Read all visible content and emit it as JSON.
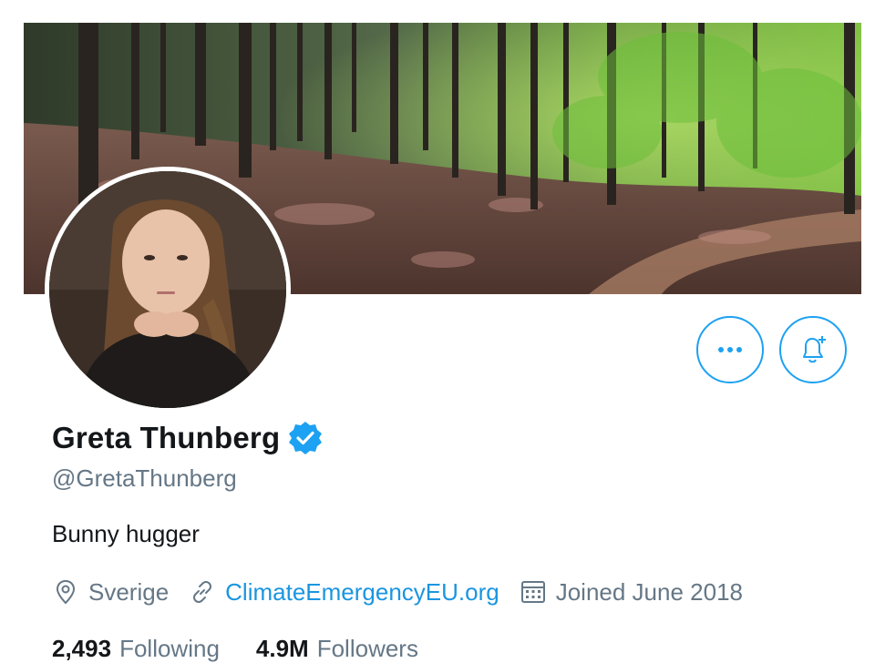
{
  "profile": {
    "display_name": "Greta Thunberg",
    "handle": "@GretaThunberg",
    "verified": true,
    "bio": "Bunny hugger",
    "location": "Sverige",
    "website": "ClimateEmergencyEU.org",
    "joined": "Joined June 2018"
  },
  "stats": {
    "following_count": "2,493",
    "following_label": "Following",
    "followers_count": "4.9M",
    "followers_label": "Followers"
  },
  "icons": {
    "more": "more-dots-icon",
    "notify": "bell-plus-icon",
    "verified": "verified-badge-icon",
    "location": "location-pin-icon",
    "link": "link-icon",
    "calendar": "calendar-icon"
  },
  "colors": {
    "accent": "#1da1f2",
    "link": "#1b95e0",
    "secondary_text": "#657786",
    "primary_text": "#14171a"
  }
}
